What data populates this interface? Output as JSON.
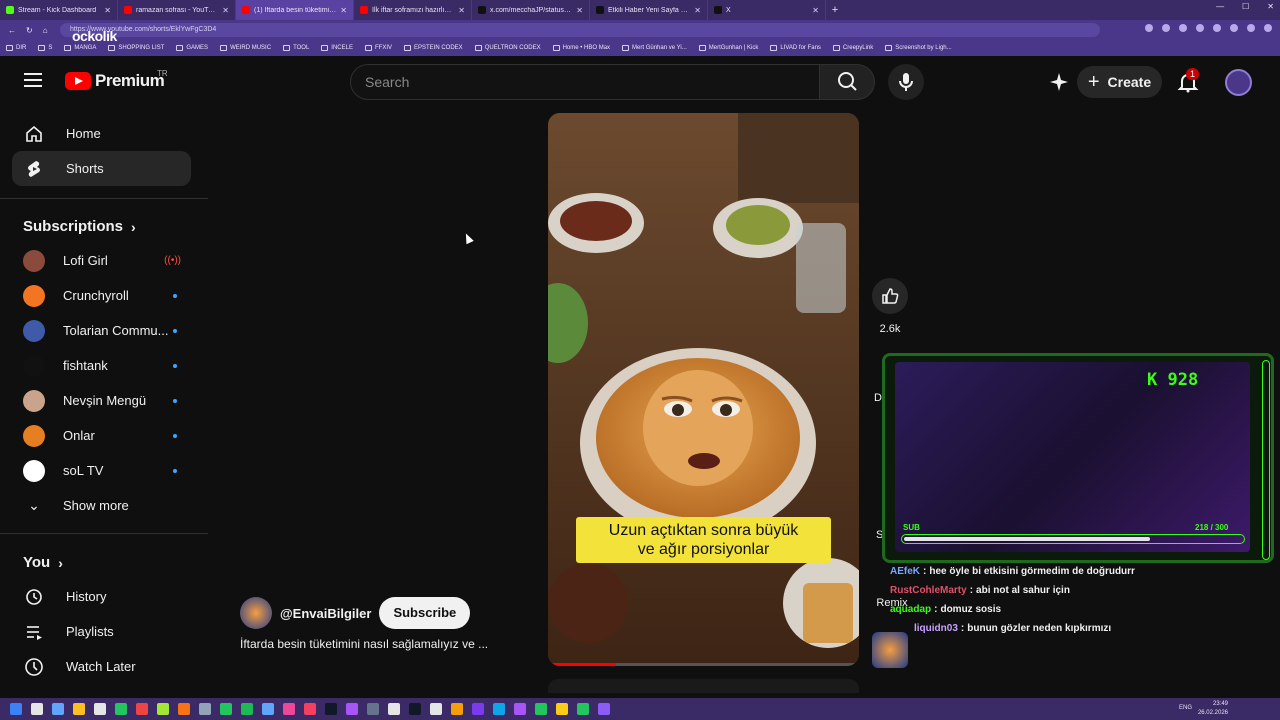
{
  "browser": {
    "tabs": [
      {
        "title": "Stream - Kick Dashboard",
        "color": "#53fc18",
        "active": false
      },
      {
        "title": "ramazan sofrası - YouTube",
        "color": "#ff0000",
        "active": false
      },
      {
        "title": "(1) İftarda besin tüketimini na",
        "color": "#ff0000",
        "active": true
      },
      {
        "title": "İlk iftar soframızı hazırlıyoruz 🍅",
        "color": "#ff0000",
        "active": false
      },
      {
        "title": "x.com/mecchaJP/status/2027020",
        "color": "#111111",
        "active": false
      },
      {
        "title": "Etkili Haber Yeni Sayfa on X: \"Alm",
        "color": "#111111",
        "active": false
      },
      {
        "title": "X",
        "color": "#111111",
        "active": false
      }
    ],
    "url": "https://www.youtube.com/shorts/EklYwFgC3D4",
    "overlay_logo": "ockolik",
    "bookmarks": [
      "DIR",
      "S",
      "MANGA",
      "SHOPPING LIST",
      "GAMES",
      "WEIRD MUSIC",
      "TOOL",
      "INCELE",
      "FFXIV",
      "EPSTEIN CODEX",
      "QUELTRON CODEX",
      "Home • HBO Max",
      "Mert Günhan ve Yi...",
      "MertGunhan | Kick",
      "LIVAD for Fans",
      "CreepyLink",
      "Screenshot by Ligh..."
    ]
  },
  "masthead": {
    "logo_text": "Premium",
    "region": "TR",
    "search_placeholder": "Search",
    "create_label": "Create",
    "notifications_count": "1"
  },
  "sidebar": {
    "nav": [
      {
        "label": "Home",
        "icon": "home-icon"
      },
      {
        "label": "Shorts",
        "icon": "shorts-icon"
      }
    ],
    "subscriptions_title": "Subscriptions",
    "subscriptions": [
      {
        "name": "Lofi Girl",
        "color": "#8a4b3c",
        "status": "live"
      },
      {
        "name": "Crunchyroll",
        "color": "#f47521",
        "status": "new"
      },
      {
        "name": "Tolarian Commu...",
        "color": "#3f5aa8",
        "status": "new"
      },
      {
        "name": "fishtank",
        "color": "#111111",
        "status": "new"
      },
      {
        "name": "Nevşin Mengü",
        "color": "#c9a38b",
        "status": "new"
      },
      {
        "name": "Onlar",
        "color": "#e67e22",
        "status": "new"
      },
      {
        "name": "soL TV",
        "color": "#ffffff",
        "status": "new"
      }
    ],
    "show_more": "Show more",
    "you_title": "You",
    "you_items": [
      {
        "label": "History",
        "icon": "history-icon"
      },
      {
        "label": "Playlists",
        "icon": "playlists-icon"
      },
      {
        "label": "Watch Later",
        "icon": "watch-later-icon"
      }
    ]
  },
  "short": {
    "caption_line1": "Uzun açtıktan sonra büyük",
    "caption_line2": "ve ağır porsiyonlar",
    "watermark": "@envaibilgiler",
    "channel": "@EnvaiBilgiler",
    "subscribe_label": "Subscribe",
    "title": "İftarda besin tüketimini nasıl sağlamalıyız ve ...",
    "likes": "2.6k",
    "dislike_label": "D",
    "share_label": "S",
    "remix_label": "Remix",
    "progress": 0.22
  },
  "stream_overlay": {
    "counter": "K 928",
    "sub_label": "SUB",
    "sub_progress": "218 / 300",
    "sub_fraction": 0.727
  },
  "chat": [
    {
      "user": "AEfeK",
      "color": "#7aa7ff",
      "text": "hee öyle bi etkisini görmedim de doğrudurr"
    },
    {
      "user": "RustCohleMarty",
      "color": "#e0506a",
      "text": "abi not al sahur için"
    },
    {
      "user": "aquadap",
      "color": "#39ff14",
      "text": "domuz sosis"
    },
    {
      "user": "liquidn03",
      "color": "#c9a0ff",
      "text": "bunun gözler neden kıpkırmızı"
    }
  ],
  "taskbar": {
    "lang": "ENG",
    "time": "23:49",
    "date": "26.02.2026"
  }
}
